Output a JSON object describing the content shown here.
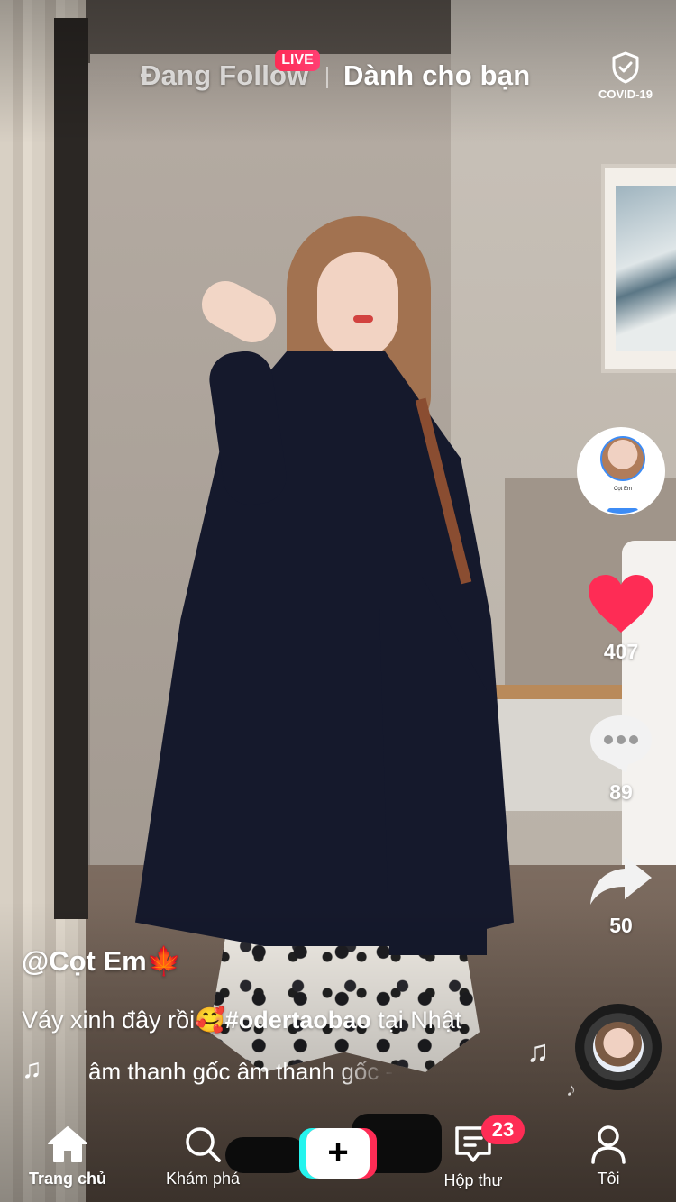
{
  "top_bar": {
    "following_tab": "Đang Follow",
    "live_badge": "LIVE",
    "for_you_tab": "Dành cho bạn",
    "covid_label": "COVID-19"
  },
  "creator": {
    "avatar_caption": "Cọt Em",
    "icon": "creator-avatar"
  },
  "actions": {
    "likes": "407",
    "comments": "89",
    "shares": "50",
    "like_color": "#fe2c55"
  },
  "post": {
    "username": "@Cọt Em🍁",
    "caption_text": "Váy xinh đây rồi🥰",
    "hashtag": "#odertaobao",
    "caption_suffix": " tại Nhật",
    "music_note": "♫",
    "music_text": "âm thanh gốc   âm thanh gốc - Cọt Em"
  },
  "bottom_nav": {
    "home": "Trang chủ",
    "discover": "Khám phá",
    "create_symbol": "+",
    "inbox": "Hộp thư",
    "inbox_badge": "23",
    "me": "Tôi"
  },
  "colors": {
    "accent_red": "#fe2c55",
    "accent_cyan": "#25f4ee"
  }
}
